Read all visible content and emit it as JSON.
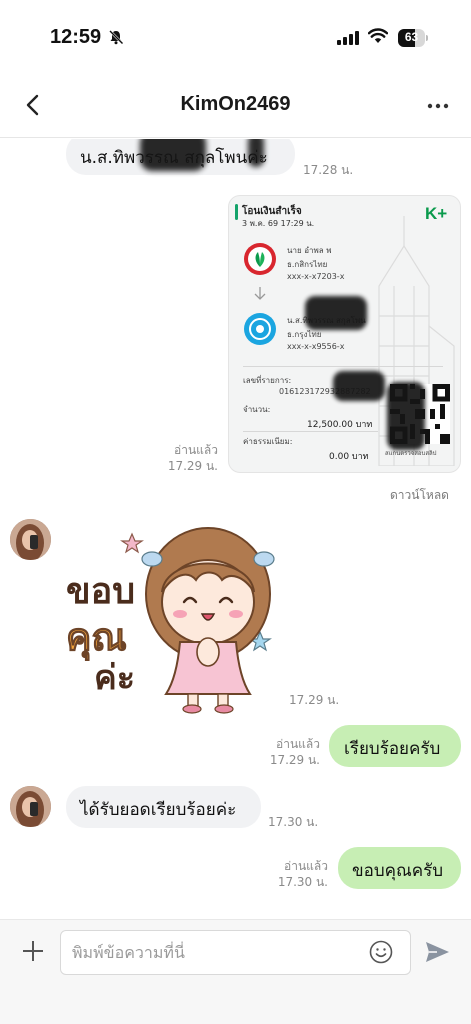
{
  "status_bar": {
    "time": "12:59",
    "battery_level": "63",
    "battery_fraction": 0.63
  },
  "header": {
    "title": "KimOn2469"
  },
  "messages": {
    "m1": {
      "text": "น.ส.ทิพวรรณ  สกุลโพนค่ะ",
      "time": "17.28 น."
    },
    "slip": {
      "read": "อ่านแล้ว",
      "time": "17.29 น.",
      "title": "โอนเงินสำเร็จ",
      "date": "3 พ.ค. 69  17:29 น.",
      "brand": "K+",
      "sender_name": "นาย อำพล พ",
      "sender_bank": "ธ.กสิกรไทย",
      "sender_account": "xxx-x-x7203-x",
      "receiver_name": "น.ส.ทิพวรรณ สกุลโพน",
      "receiver_bank": "ธ.กรุงไทย",
      "receiver_account": "xxx-x-x9556-x",
      "ref_label": "เลขที่รายการ:",
      "ref_value": "016123172932887282",
      "amount_label": "จำนวน:",
      "amount_value": "12,500.00 บาท",
      "fee_label": "ค่าธรรมเนียม:",
      "fee_value": "0.00 บาท",
      "qr_caption": "สแกนตรวจสอบสลิป",
      "download": "ดาวน์โหลด"
    },
    "sticker": {
      "line1": "ขอบ",
      "line2": "คุณ",
      "line3": "ค่ะ",
      "time": "17.29 น."
    },
    "m2": {
      "read": "อ่านแล้ว",
      "time": "17.29 น.",
      "text": "เรียบร้อยครับ"
    },
    "m3": {
      "text": "ได้รับยอดเรียบร้อยค่ะ",
      "time": "17.30 น."
    },
    "m4": {
      "read": "อ่านแล้ว",
      "time": "17.30 น.",
      "text": "ขอบคุณครับ"
    }
  },
  "input": {
    "placeholder": "พิมพ์ข้อความที่นี่"
  },
  "colors": {
    "outgoing_bubble": "#c7eeb4",
    "incoming_bubble": "#f1f2f4",
    "kplus_green": "#0a9a4c"
  }
}
